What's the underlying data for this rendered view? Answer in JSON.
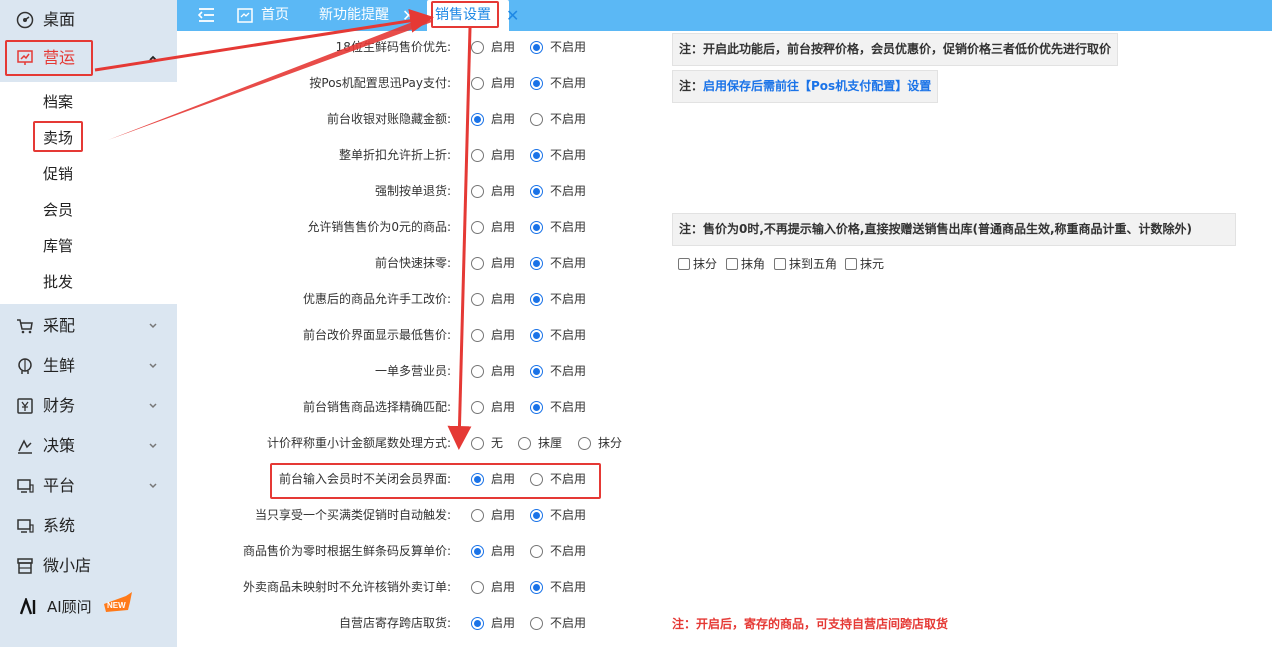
{
  "sidebar": {
    "desktop": "桌面",
    "operations": "营运",
    "sub": [
      "档案",
      "卖场",
      "促销",
      "会员",
      "库管",
      "批发"
    ],
    "purchase": "采配",
    "fresh": "生鲜",
    "finance": "财务",
    "decision": "决策",
    "platform": "平台",
    "system": "系统",
    "microshop": "微小店",
    "ai": "AI顾问",
    "ai_badge": "NEW"
  },
  "tabs": {
    "home": "首页",
    "new_feature": "新功能提醒",
    "sales_settings": "销售设置",
    "close": "✕"
  },
  "options": {
    "enable": "启用",
    "disable": "不启用",
    "none": "无",
    "round_jiao": "抹厘",
    "round_fen": "抹分"
  },
  "settings": [
    {
      "label": "18位生鲜码售价优先:",
      "choice": "disable"
    },
    {
      "label": "按Pos机配置思迅Pay支付:",
      "choice": "disable"
    },
    {
      "label": "前台收银对账隐藏金额:",
      "choice": "enable"
    },
    {
      "label": "整单折扣允许折上折:",
      "choice": "disable"
    },
    {
      "label": "强制按单退货:",
      "choice": "disable"
    },
    {
      "label": "允许销售售价为0元的商品:",
      "choice": "disable"
    },
    {
      "label": "前台快速抹零:",
      "choice": "disable"
    },
    {
      "label": "优惠后的商品允许手工改价:",
      "choice": "disable"
    },
    {
      "label": "前台改价界面显示最低售价:",
      "choice": "disable"
    },
    {
      "label": "一单多营业员:",
      "choice": "disable"
    },
    {
      "label": "前台销售商品选择精确匹配:",
      "choice": "disable"
    },
    {
      "label": "计价秤称重小计金额尾数处理方式:",
      "choice": "none"
    },
    {
      "label": "前台输入会员时不关闭会员界面:",
      "choice": "enable"
    },
    {
      "label": "当只享受一个买满类促销时自动触发:",
      "choice": "disable"
    },
    {
      "label": "商品售价为零时根据生鲜条码反算单价:",
      "choice": "enable"
    },
    {
      "label": "外卖商品未映射时不允许核销外卖订单:",
      "choice": "disable"
    },
    {
      "label": "自营店寄存跨店取货:",
      "choice": "enable"
    }
  ],
  "notes": {
    "n1": "注：开启此功能后，前台按秤价格，会员优惠价，促销价格三者低价优先进行取价",
    "n2_prefix": "注：",
    "n2_link": "启用保存后需前往【Pos机支付配置】设置",
    "n3": "注：售价为0时,不再提示输入价格,直接按赠送销售出库(普通商品生效,称重商品计重、计数除外)",
    "n4": "注：开启后，寄存的商品，可支持自营店间跨店取货"
  },
  "rounding": [
    "抹分",
    "抹角",
    "抹到五角",
    "抹元"
  ],
  "colors": {
    "topbar": "#5bb8f5",
    "sidebar": "#dbe6f1",
    "highlight": "#e53935",
    "accent": "#1a73e8"
  }
}
